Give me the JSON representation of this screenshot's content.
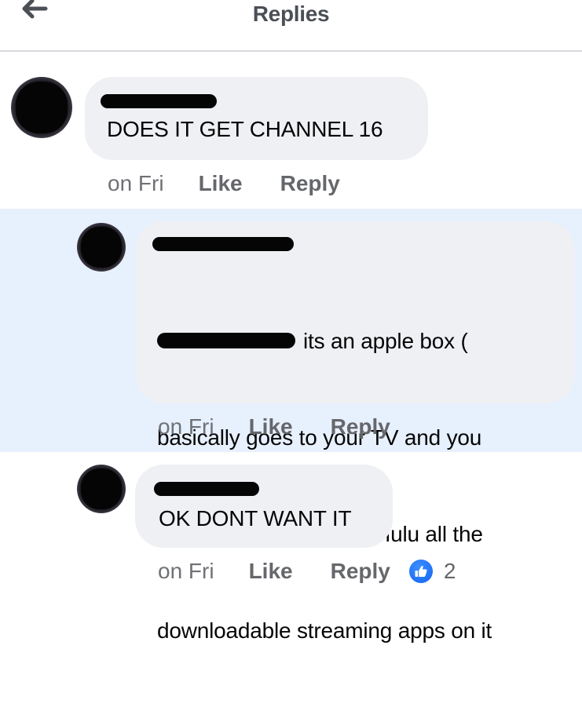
{
  "header": {
    "back_icon": "arrow-left-icon",
    "title": "Replies"
  },
  "colors": {
    "highlight_bg": "#e7f0fd",
    "bubble_bg": "#eff0f4",
    "action_text": "#65676b",
    "like_blue": "#1877f2"
  },
  "comments": [
    {
      "author": "[redacted]",
      "text": "DOES IT GET CHANNEL 16",
      "time": "on Fri",
      "like_label": "Like",
      "reply_label": "Reply"
    },
    {
      "author": "[redacted]",
      "mention": "[redacted]",
      "text": "its an apple box (\nbasically goes to your TV and you\ncan watch your Netflix Hulu all the\ndownloadable streaming apps on it",
      "line1": "its an apple box (",
      "line2": "basically goes to your TV and you",
      "line3": "can watch your Netflix Hulu all the",
      "line4": "downloadable streaming apps on it",
      "time": "on Fri",
      "like_label": "Like",
      "reply_label": "Reply",
      "highlighted": true
    },
    {
      "author": "[redacted]",
      "text": "OK DONT WANT IT",
      "time": "on Fri",
      "like_label": "Like",
      "reply_label": "Reply",
      "reaction_icon": "thumbs-up-icon",
      "reaction_count": "2"
    }
  ]
}
